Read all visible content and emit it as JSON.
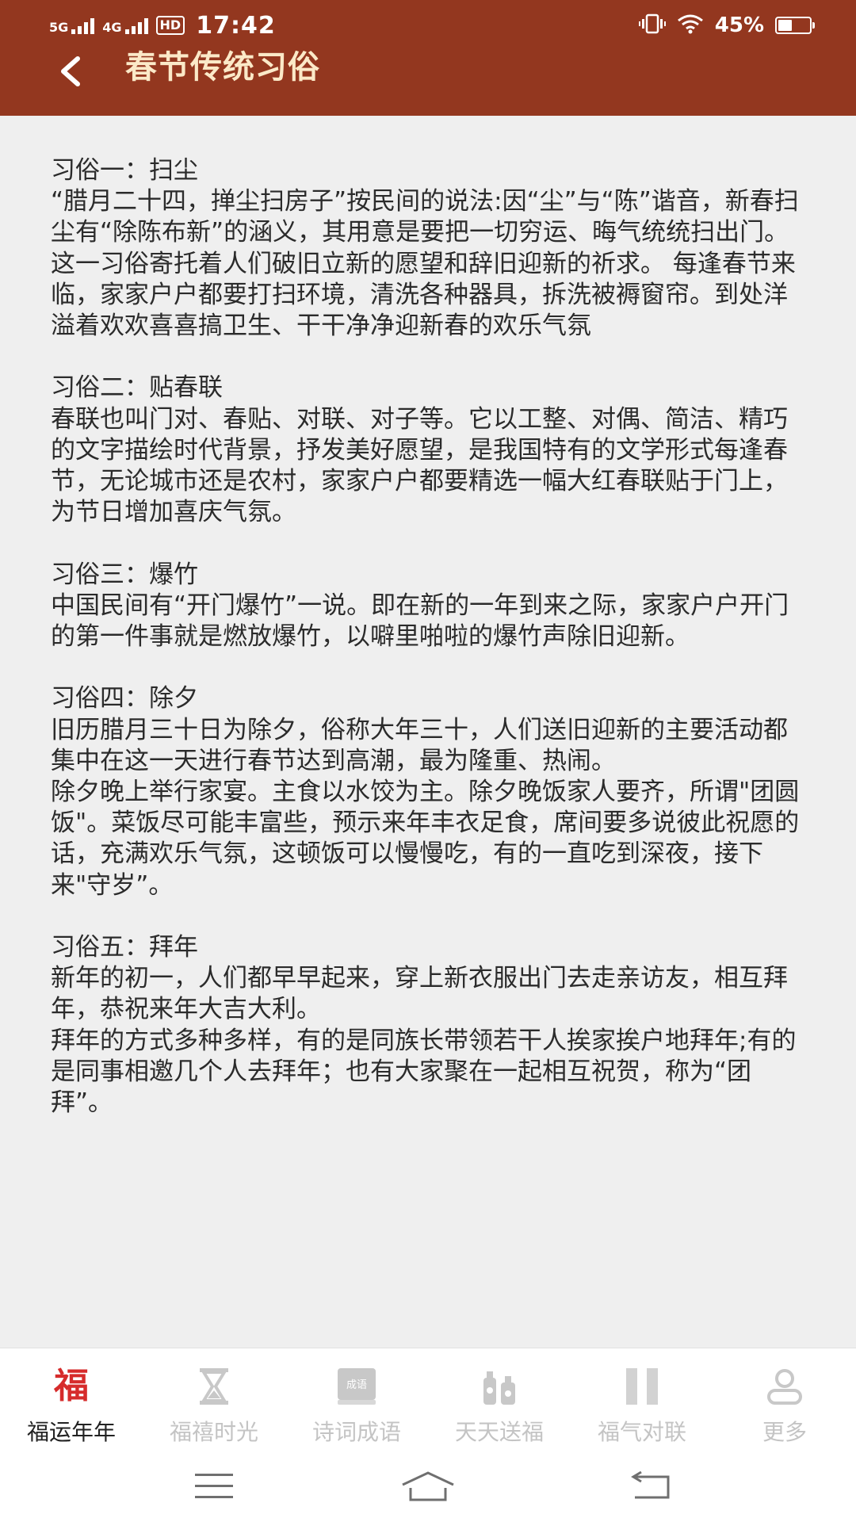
{
  "status_bar": {
    "network1": "5G",
    "network2": "4G",
    "hd_label": "HD",
    "time": "17:42",
    "battery_percent": "45%",
    "battery_level": 0.45
  },
  "header": {
    "title": "春节传统习俗"
  },
  "article": {
    "sections": [
      {
        "title": "习俗一：扫尘",
        "paragraphs": [
          "“腊月二十四，掸尘扫房子”按民间的说法:因“尘”与“陈”谐音，新春扫尘有“除陈布新”的涵义，其用意是要把一切穷运、晦气统统扫出门。这一习俗寄托着人们破旧立新的愿望和辞旧迎新的祈求。 每逢春节来临，家家户户都要打扫环境，清洗各种器具，拆洗被褥窗帘。到处洋溢着欢欢喜喜搞卫生、干干净净迎新春的欢乐气氛"
        ]
      },
      {
        "title": "习俗二：贴春联",
        "paragraphs": [
          "春联也叫门对、春贴、对联、对子等。它以工整、对偶、简洁、精巧的文字描绘时代背景，抒发美好愿望，是我国特有的文学形式每逢春节，无论城市还是农村，家家户户都要精选一幅大红春联贴于门上，为节日增加喜庆气氛。"
        ]
      },
      {
        "title": "习俗三：爆竹",
        "paragraphs": [
          "中国民间有“开门爆竹”一说。即在新的一年到来之际，家家户户开门的第一件事就是燃放爆竹，以噼里啪啦的爆竹声除旧迎新。"
        ]
      },
      {
        "title": "习俗四：除夕",
        "paragraphs": [
          "旧历腊月三十日为除夕，俗称大年三十，人们送旧迎新的主要活动都集中在这一天进行春节达到高潮，最为隆重、热闹。",
          "除夕晚上举行家宴。主食以水饺为主。除夕晚饭家人要齐，所谓\"团圆饭\"。菜饭尽可能丰富些，预示来年丰衣足食，席间要多说彼此祝愿的话，充满欢乐气氛，这顿饭可以慢慢吃，有的一直吃到深夜，接下来\"守岁”。"
        ]
      },
      {
        "title": "习俗五：拜年",
        "paragraphs": [
          "新年的初一，人们都早早起来，穿上新衣服出门去走亲访友，相互拜年，恭祝来年大吉大利。",
          "拜年的方式多种多样，有的是同族长带领若干人挨家挨户地拜年;有的是同事相邀几个人去拜年；也有大家聚在一起相互祝贺，称为“团拜”。"
        ]
      }
    ]
  },
  "bottom_nav": {
    "items": [
      {
        "label": "福运年年",
        "icon": "fu-icon",
        "glyph": "福",
        "active": true
      },
      {
        "label": "福禧时光",
        "icon": "hourglass-icon",
        "active": false
      },
      {
        "label": "诗词成语",
        "icon": "book-icon",
        "badge": "成语",
        "active": false
      },
      {
        "label": "天天送福",
        "icon": "gift-bottles-icon",
        "active": false
      },
      {
        "label": "福气对联",
        "icon": "couplet-icon",
        "active": false
      },
      {
        "label": "更多",
        "icon": "user-icon",
        "active": false
      }
    ]
  },
  "colors": {
    "header_bg": "#93371f",
    "title_color": "#fbe9c8",
    "content_bg": "#efefef",
    "active_icon": "#d62b2b",
    "inactive": "#c4c4c4"
  }
}
